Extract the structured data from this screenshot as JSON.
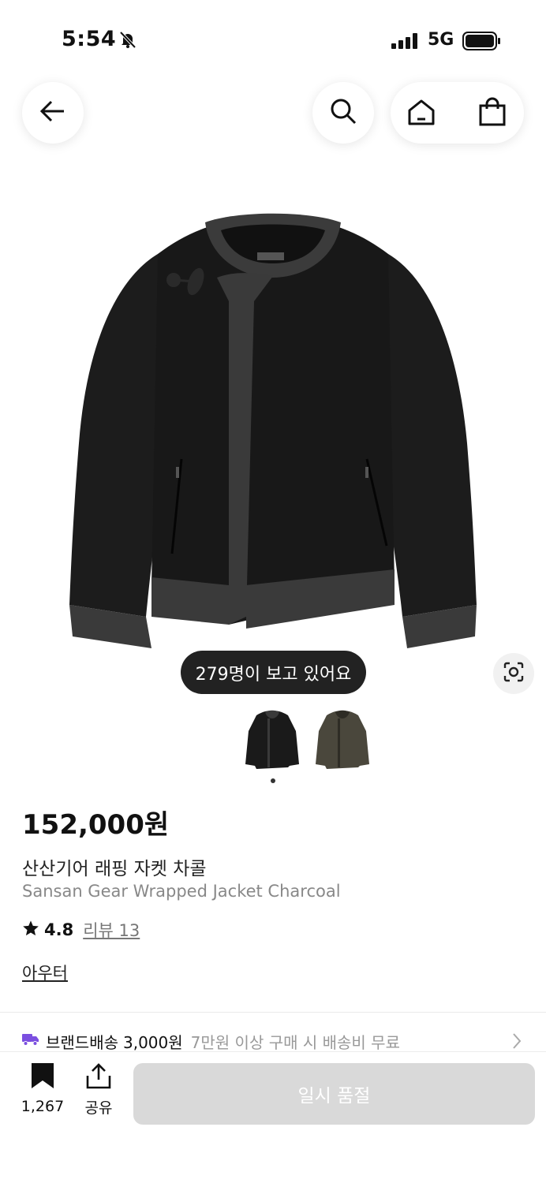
{
  "status_bar": {
    "time": "5:54",
    "network": "5G",
    "icons": [
      "bell-slash-icon",
      "signal-icon",
      "battery-icon"
    ]
  },
  "header": {
    "icons": [
      "back-arrow-icon",
      "search-icon",
      "home-icon",
      "shopping-bag-icon"
    ]
  },
  "gallery": {
    "viewers_text": "279명이 보고 있어요",
    "thumbnails": [
      {
        "color": "black",
        "selected": true
      },
      {
        "color": "olive",
        "selected": false
      }
    ]
  },
  "product": {
    "price": "152,000원",
    "name_ko": "산산기어 래핑 자켓 차콜",
    "name_en": "Sansan Gear Wrapped Jacket Charcoal",
    "rating": "4.8",
    "review_label": "리뷰 13",
    "category": "아우터"
  },
  "shipping": {
    "label": "브랜드배송",
    "fee": "3,000원",
    "condition": "7만원 이상 구매 시 배송비 무료"
  },
  "bottom_bar": {
    "bookmark_count": "1,267",
    "share_label": "공유",
    "cta_label": "일시 품절"
  },
  "colors": {
    "accent": "#7b4fe0",
    "badge_bg": "#222222",
    "cta_disabled": "#d9d9d9"
  }
}
